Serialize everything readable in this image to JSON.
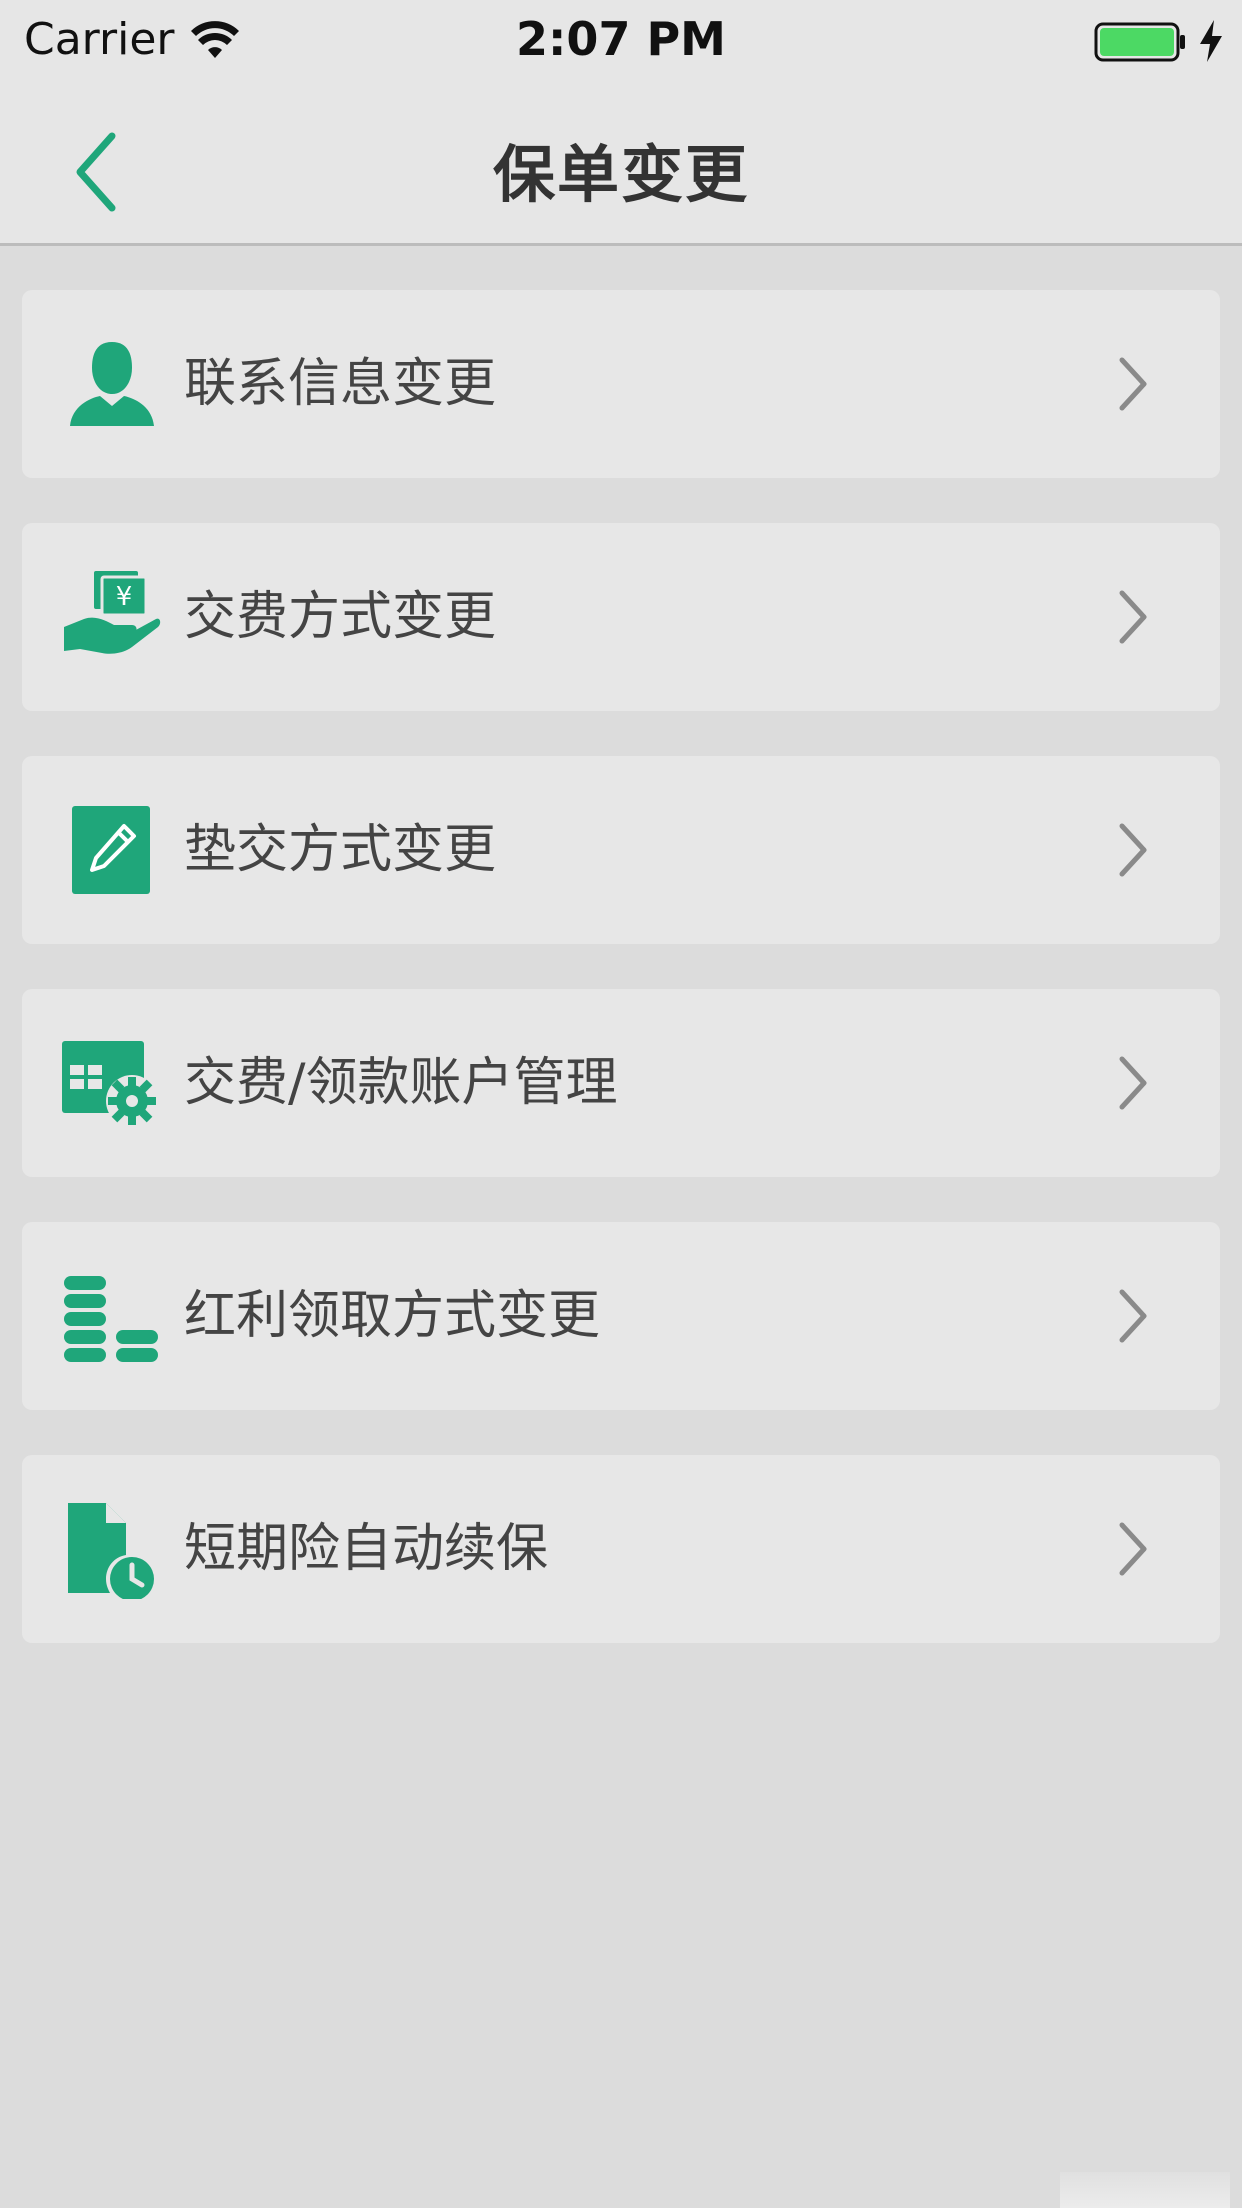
{
  "status_bar": {
    "carrier": "Carrier",
    "time": "2:07 PM",
    "wifi_icon": "wifi-icon",
    "battery_icon": "battery-charging-icon",
    "battery_color": "#4cd964"
  },
  "nav": {
    "back_icon": "chevron-left-icon",
    "title": "保单变更",
    "accent_color": "#1fa67a"
  },
  "menu": {
    "items": [
      {
        "label": "联系信息变更",
        "icon": "person-icon"
      },
      {
        "label": "交费方式变更",
        "icon": "money-hand-icon"
      },
      {
        "label": "垫交方式变更",
        "icon": "edit-document-icon"
      },
      {
        "label": "交费/领款账户管理",
        "icon": "account-settings-icon"
      },
      {
        "label": "红利领取方式变更",
        "icon": "coins-icon"
      },
      {
        "label": "短期险自动续保",
        "icon": "document-clock-icon"
      }
    ],
    "chevron_icon": "chevron-right-icon"
  }
}
